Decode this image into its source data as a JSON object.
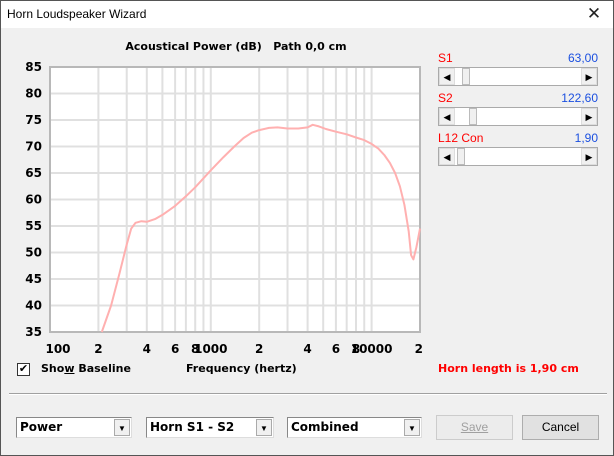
{
  "window": {
    "title": "Horn Loudspeaker Wizard",
    "close_icon": "close-icon"
  },
  "chart_title": "Acoustical Power (dB)   Path 0,0 cm",
  "sliders": [
    {
      "label": "S1",
      "value": "63,00",
      "position": 0.06
    },
    {
      "label": "S2",
      "value": "122,60",
      "position": 0.12
    },
    {
      "label": "L12  Con",
      "value": "1,90",
      "position": 0.02
    }
  ],
  "show_baseline": {
    "label_pre": "Sho",
    "label_u": "w",
    "label_post": " Baseline",
    "checked": true
  },
  "horn_length": "Horn length is 1,90 cm",
  "dropdowns": [
    {
      "value": "Power"
    },
    {
      "value": "Horn S1 - S2"
    },
    {
      "value": "Combined"
    }
  ],
  "buttons": {
    "save": "Save",
    "cancel": "Cancel"
  },
  "colors": {
    "curve": "#ffb0b0",
    "label_red": "#ff0000",
    "value_blue": "#1a4fe0"
  },
  "chart_data": {
    "type": "line",
    "title": "Acoustical Power (dB)   Path 0,0 cm",
    "xlabel": "Frequency (hertz)",
    "ylabel": "",
    "xscale": "log",
    "xlim": [
      100,
      20000
    ],
    "ylim": [
      35,
      85
    ],
    "grid": true,
    "yticks": [
      35,
      40,
      45,
      50,
      55,
      60,
      65,
      70,
      75,
      80,
      85
    ],
    "xticks": [
      {
        "v": 100,
        "t": "100"
      },
      {
        "v": 200,
        "t": "2"
      },
      {
        "v": 400,
        "t": "4"
      },
      {
        "v": 600,
        "t": "6"
      },
      {
        "v": 800,
        "t": "8"
      },
      {
        "v": 1000,
        "t": "1000"
      },
      {
        "v": 2000,
        "t": "2"
      },
      {
        "v": 4000,
        "t": "4"
      },
      {
        "v": 6000,
        "t": "6"
      },
      {
        "v": 8000,
        "t": "8"
      },
      {
        "v": 10000,
        "t": "10000"
      },
      {
        "v": 20000,
        "t": "2"
      }
    ],
    "series": [
      {
        "name": "Power",
        "x": [
          210,
          240,
          270,
          300,
          320,
          340,
          370,
          400,
          450,
          500,
          600,
          700,
          800,
          1000,
          1200,
          1400,
          1600,
          1800,
          2000,
          2300,
          2600,
          3000,
          3500,
          4000,
          4300,
          4700,
          5200,
          6000,
          7000,
          8000,
          9000,
          10000,
          11000,
          12000,
          13000,
          14000,
          15000,
          16000,
          17000,
          17600,
          18200,
          19000,
          20000
        ],
        "y": [
          35,
          40,
          46,
          51.5,
          54.5,
          55.6,
          55.9,
          55.8,
          56.3,
          57.1,
          58.8,
          60.6,
          62.3,
          65.5,
          68,
          70,
          71.6,
          72.6,
          73.1,
          73.5,
          73.6,
          73.4,
          73.4,
          73.6,
          74.1,
          73.8,
          73.3,
          72.8,
          72.3,
          71.7,
          71.2,
          70.5,
          69.6,
          68.4,
          66.9,
          65,
          62.5,
          59,
          54,
          49.5,
          48.7,
          51,
          54.5
        ]
      }
    ]
  }
}
